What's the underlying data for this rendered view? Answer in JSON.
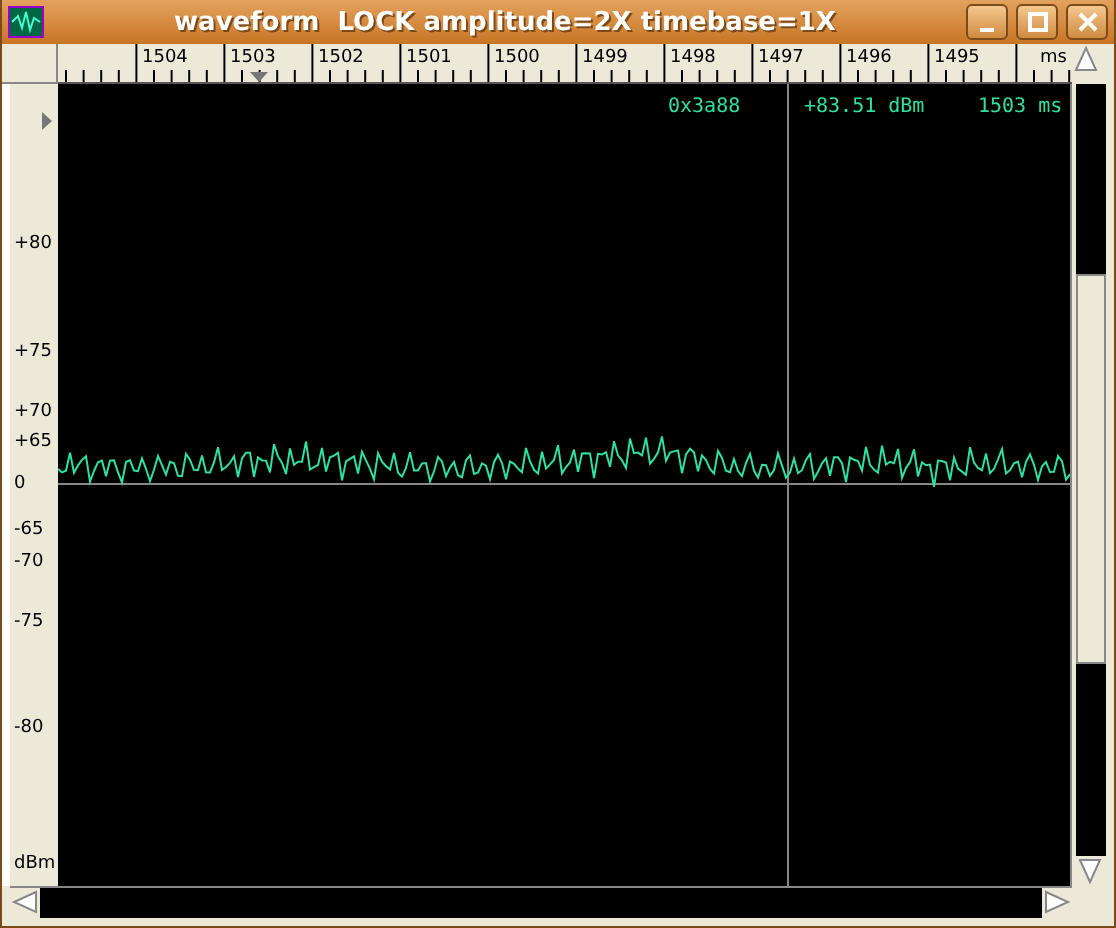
{
  "window": {
    "title": "waveform  LOCK amplitude=2X timebase=1X"
  },
  "top_ruler": {
    "labels": [
      "1504",
      "1503",
      "1502",
      "1501",
      "1500",
      "1499",
      "1498",
      "1497",
      "1496",
      "1495"
    ],
    "unit": "ms"
  },
  "left_ruler": {
    "labels": [
      "+80",
      "+75",
      "+70",
      "+65",
      "0",
      "-65",
      "-70",
      "-75",
      "-80"
    ],
    "unit": "dBm"
  },
  "readout": {
    "address": "0x3a88",
    "level": "+83.51 dBm",
    "time": "1503 ms"
  }
}
